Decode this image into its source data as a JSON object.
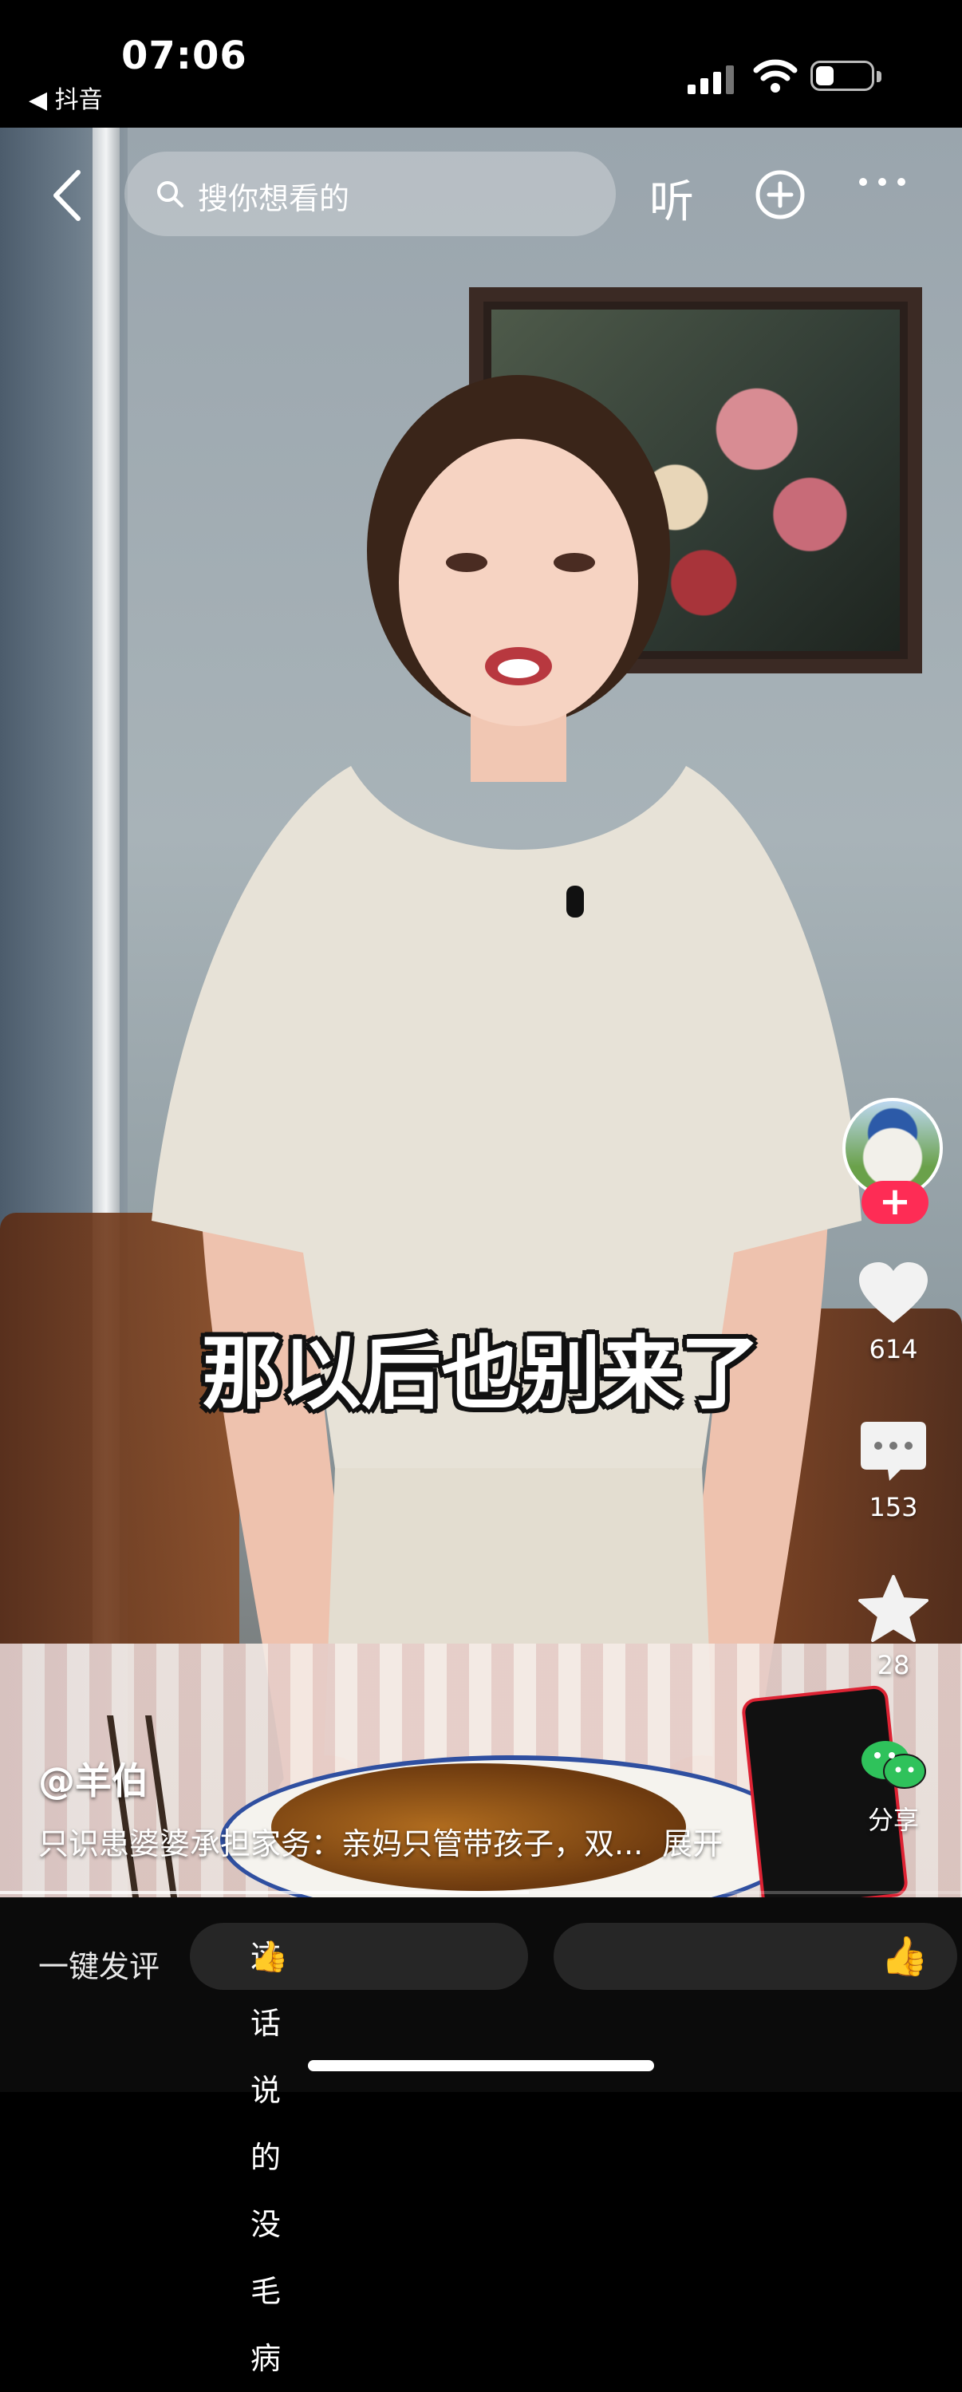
{
  "status_bar": {
    "time": "07:06",
    "back_app": "◀ 抖音",
    "signal_icon": "cellular-signal-icon",
    "wifi_icon": "wifi-icon",
    "battery_level": 0.25
  },
  "top_nav": {
    "search_placeholder": "搜你想看的",
    "listen_label": "听"
  },
  "video": {
    "caption": "那以后也别来了"
  },
  "actions": {
    "like_count": "614",
    "comment_count": "153",
    "favorite_count": "28",
    "share_label": "分享",
    "follow_symbol": "+"
  },
  "post": {
    "author": "@羊伯",
    "description": "只识患婆婆承担家务：亲妈只管带孩子，双...",
    "expand_label": "展开",
    "progress": 0.55
  },
  "comment_bar": {
    "label": "一键发评",
    "suggestions": [
      {
        "text": "这话说的没毛病",
        "emoji": "👍"
      },
      {
        "text": "",
        "emoji": "👍"
      }
    ]
  },
  "colors": {
    "follow_red": "#fe2c55",
    "background": "#000000"
  }
}
